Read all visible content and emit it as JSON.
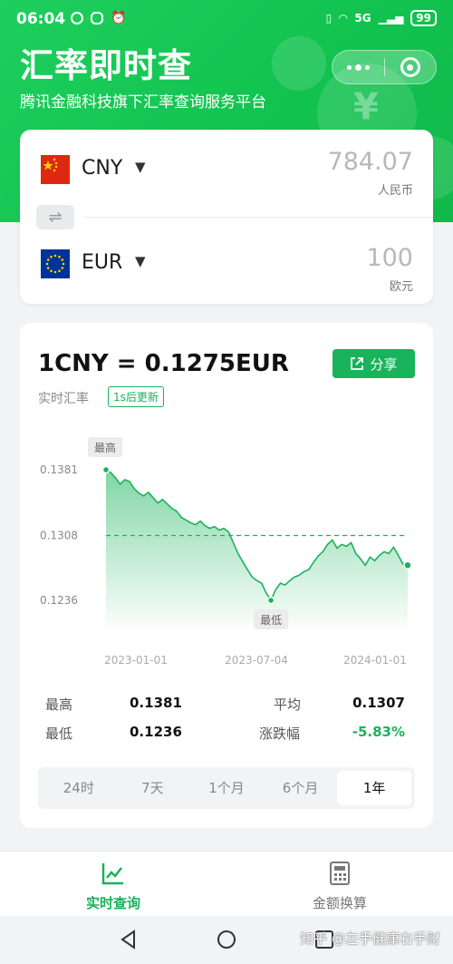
{
  "status": {
    "time": "06:04",
    "network": "5G",
    "battery": "99"
  },
  "header": {
    "title": "汇率即时查",
    "subtitle": "腾讯金融科技旗下汇率查询服务平台"
  },
  "converter": {
    "from": {
      "code": "CNY",
      "amount": "784.07",
      "unit": "人民币",
      "flag_icon": "china-flag-icon"
    },
    "to": {
      "code": "EUR",
      "amount": "100",
      "unit": "欧元",
      "flag_icon": "eu-flag-icon"
    },
    "swap_icon": "swap-arrows-icon"
  },
  "rate": {
    "main": "1CNY = 0.1275EUR",
    "label": "实时汇率",
    "update_badge": "1s后更新",
    "share_label": "分享"
  },
  "chart_data": {
    "type": "area",
    "y_ticks": [
      "0.1381",
      "0.1308",
      "0.1236"
    ],
    "x_ticks": [
      "2023-01-01",
      "2023-07-04",
      "2024-01-01"
    ],
    "ylim": [
      0.1236,
      0.1381
    ],
    "average_line": 0.1308,
    "max_marker_label": "最高",
    "min_marker_label": "最低",
    "series_color": "#18b35a",
    "values": [
      0.1381,
      0.1378,
      0.1372,
      0.1365,
      0.137,
      0.1368,
      0.136,
      0.1355,
      0.1352,
      0.1356,
      0.135,
      0.1344,
      0.1348,
      0.1343,
      0.1338,
      0.1335,
      0.1328,
      0.1325,
      0.1322,
      0.132,
      0.1324,
      0.1319,
      0.1316,
      0.1318,
      0.1314,
      0.1316,
      0.1312,
      0.13,
      0.1288,
      0.1279,
      0.127,
      0.1262,
      0.1258,
      0.1255,
      0.1244,
      0.1236,
      0.1248,
      0.1255,
      0.1253,
      0.1258,
      0.1262,
      0.1264,
      0.1268,
      0.127,
      0.1278,
      0.1285,
      0.129,
      0.1298,
      0.1303,
      0.1294,
      0.1298,
      0.1296,
      0.13,
      0.1288,
      0.1282,
      0.1275,
      0.1284,
      0.128,
      0.1286,
      0.129,
      0.1288,
      0.1295,
      0.1286,
      0.1276,
      0.1275
    ]
  },
  "stats": {
    "high_label": "最高",
    "high_value": "0.1381",
    "avg_label": "平均",
    "avg_value": "0.1307",
    "low_label": "最低",
    "low_value": "0.1236",
    "change_label": "涨跌幅",
    "change_value": "-5.83%"
  },
  "periods": [
    "24时",
    "7天",
    "1个月",
    "6个月",
    "1年"
  ],
  "active_period": "1年",
  "nav": {
    "realtime_label": "实时查询",
    "calc_label": "金额换算"
  },
  "watermark": "知乎 @左手健康右手财",
  "colors": {
    "brand": "#18b35a",
    "header": "#16c653",
    "negative": "#18b35a"
  }
}
